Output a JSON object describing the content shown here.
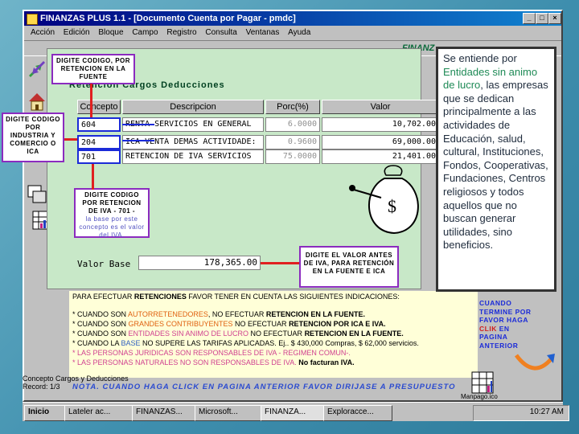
{
  "window": {
    "title": "FINANZAS PLUS 1.1 - [Documento Cuenta por Pagar - pmdc]",
    "menu": [
      "Acción",
      "Edición",
      "Bloque",
      "Campo",
      "Registro",
      "Consulta",
      "Ventanas",
      "Ayuda"
    ],
    "toolbar_logo": "FINANZ"
  },
  "form": {
    "title": "Retención Cargos Deducciones",
    "columns": [
      "Concepto",
      "Descripcion",
      "Porc(%)",
      "Valor"
    ],
    "rows": [
      {
        "code": "604",
        "desc": "RENTA SERVICIOS EN GENERAL",
        "pct": "6.0000",
        "value": "10,702.00"
      },
      {
        "code": "204",
        "desc": "ICA VENTA DEMAS ACTIVIDADE:",
        "pct": "0.9600",
        "value": "69,000.00"
      },
      {
        "code": "701",
        "desc": "RETENCION DE IVA SERVICIOS",
        "pct": "75.0000",
        "value": "21,401.00"
      }
    ],
    "base_label": "Valor Base",
    "base_value": "178,365.00"
  },
  "callouts": {
    "retencion_fuente": "DIGITE CODIGO, POR RETENCION EN LA FUENTE",
    "ica": "DIGITE CODIGO POR INDUSTRIA Y COMERCIO O ICA",
    "iva_main": "DIGITE CODIGO POR RETENCION DE IVA - 701 -",
    "iva_sub": "la base por este concepto es el valor del IVA.",
    "valor": "DIGITE EL VALOR ANTES DE IVA, PARA RETENCIÓN EN LA FUENTE E ICA"
  },
  "info": {
    "intro_a": "PARA EFECTUAR ",
    "intro_b": "RETENCIONES",
    "intro_c": " FAVOR TENER EN CUENTA LAS SIGUIENTES INDICACIONES:",
    "l1a": "* CUANDO SON ",
    "l1b": "AUTORRETENEDORES",
    "l1c": ", NO EFECTUAR ",
    "l1d": "RETENCION EN LA FUENTE.",
    "l2a": "* CUANDO SON ",
    "l2b": "GRANDES CONTRIBUYENTES",
    "l2c": " NO EFECTUAR ",
    "l2d": "RETENCION POR ICA E IVA.",
    "l3a": "* CUANDO SON ",
    "l3b": "ENTIDADES SIN ANIMO DE LUCRO",
    "l3c": " NO EFECTUAR ",
    "l3d": "RETENCION EN LA FUENTE.",
    "l4a": "* CUANDO LA ",
    "l4b": "BASE",
    "l4c": " NO SUPERE LAS TARIFAS APLICADAS. Ej.. $ 430,000 Compras, $ 62,000 servicios.",
    "l5": "* LAS PERSONAS JURIDICAS SON RESPONSABLES DE IVA - REGIMEN COMUN-.",
    "l6a": "* LAS PERSONAS NATURALES NO SON RESPONSABLES DE IVA. ",
    "l6b": "No facturan IVA.",
    "nota": "NOTA. CUANDO HAGA CLICK EN PAGINA ANTERIOR FAVOR DIRIJASE A PRESUPUESTO"
  },
  "terminar": {
    "a": "CUANDO TERMINE POR FAVOR HAGA ",
    "b": "CLIK",
    "c": " EN PAGINA ANTERIOR"
  },
  "panel": {
    "a": "Se entiende por ",
    "b": "Entidades sin animo de lucro",
    "c": ", las empresas que se dedican principalmente a las actividades de Educación, salud, cultural, Instituciones, Fondos, Cooperativas, Fundaciones, Centros religiosos y todos aquellos que no buscan generar utilidades, sino beneficios."
  },
  "status": {
    "line1": "Concepto Cargos y Deducciones",
    "line2": "Record: 1/3"
  },
  "taskbar": {
    "start": "Inicio",
    "items": [
      "Lateler ac...",
      "FINANZAS...",
      "Microsoft...",
      "FINANZA...",
      "Exploracce..."
    ],
    "clock": "10:27 AM",
    "tray_label": "Manpago.ico"
  }
}
